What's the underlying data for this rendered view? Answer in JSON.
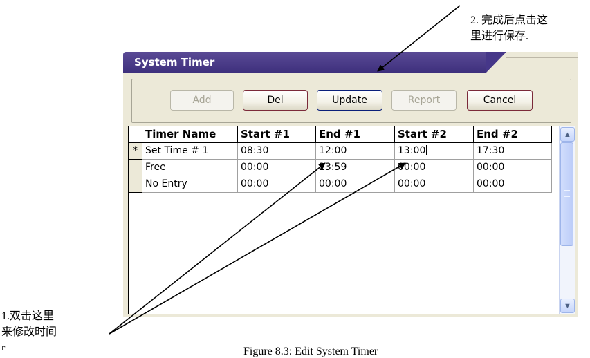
{
  "window": {
    "title": "System Timer"
  },
  "toolbar": {
    "add_label": "Add",
    "del_label": "Del",
    "update_label": "Update",
    "report_label": "Report",
    "cancel_label": "Cancel"
  },
  "table": {
    "columns": [
      "Timer Name",
      "Start #1",
      "End #1",
      "Start #2",
      "End #2"
    ],
    "rows": [
      {
        "marker": "*",
        "cells": [
          "Set Time # 1",
          "08:30",
          "12:00",
          "13:00",
          "17:30"
        ]
      },
      {
        "marker": "",
        "cells": [
          "Free",
          "00:00",
          "23:59",
          "00:00",
          "00:00"
        ]
      },
      {
        "marker": "",
        "cells": [
          "No Entry",
          "00:00",
          "00:00",
          "00:00",
          "00:00"
        ]
      }
    ]
  },
  "scrollbar": {
    "up_icon": "scroll-up-arrow",
    "down_icon": "scroll-down-arrow"
  },
  "annotations": {
    "note_save_line1": "2. 完成后点击这",
    "note_save_line2": "里进行保存.",
    "note_edit_line1": "1.双击这里",
    "note_edit_line2": "来修改时间",
    "note_edit_line3": "r",
    "caption": "Figure 8.3: Edit System Timer"
  },
  "colors": {
    "title_bar": "#3d2f7c",
    "window_body": "#ece9d8",
    "scrollbar_accent": "#9eb5ea"
  }
}
